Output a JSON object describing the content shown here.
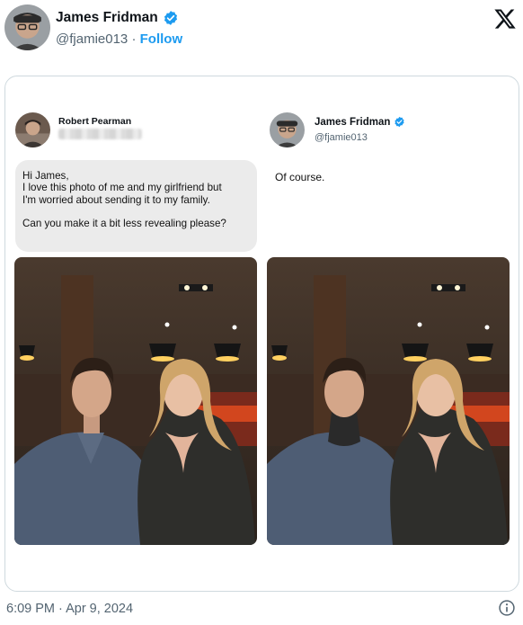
{
  "tweet": {
    "author_name": "James Fridman",
    "author_handle": "@fjamie013",
    "separator": "·",
    "follow_label": "Follow",
    "timestamp": "6:09 PM · Apr 9, 2024",
    "verified_icon": "verified-badge-icon",
    "platform_icon": "x-logo-icon",
    "info_icon": "info-icon"
  },
  "card": {
    "request": {
      "sender_name": "Robert Pearman",
      "lines": [
        "Hi James,",
        "I love this photo of me and my girlfriend but",
        "I'm worried about sending it to my family.",
        "Can you make it a bit less revealing please?"
      ]
    },
    "response": {
      "author_name": "James Fridman",
      "author_handle": "@fjamie013",
      "text": "Of course."
    },
    "photos": [
      "original-photo",
      "edited-photo"
    ]
  },
  "colors": {
    "accent": "#1d9bf0",
    "text": "#0f1419",
    "muted": "#536471",
    "bubble": "#ebebeb",
    "border": "#cfd9de"
  }
}
